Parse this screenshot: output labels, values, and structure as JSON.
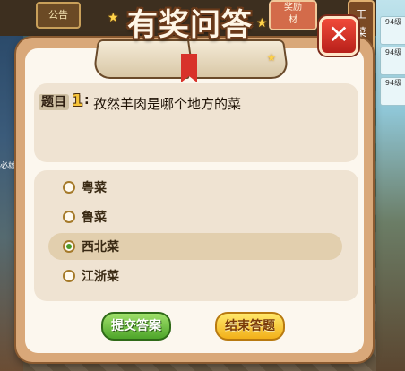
{
  "background": {
    "notice_label": "公告",
    "corner_chip": "奖励\n材",
    "sidebar_tab": "工\n菜",
    "right_cards": [
      "94级",
      "94级",
      "94级"
    ],
    "left_text": "必雄"
  },
  "dialog": {
    "title": "有奖问答",
    "close_glyph": "✕",
    "question": {
      "label": "题目",
      "number": "1",
      "colon": ":",
      "text": "孜然羊肉是哪个地方的菜"
    },
    "options": [
      {
        "label": "粤菜",
        "selected": false
      },
      {
        "label": "鲁菜",
        "selected": false
      },
      {
        "label": "西北菜",
        "selected": true
      },
      {
        "label": "江浙菜",
        "selected": false
      }
    ],
    "submit_label": "提交答案",
    "end_label": "结束答题"
  },
  "colors": {
    "accent_green": "#4ea52a",
    "accent_yellow": "#f2b01a",
    "close_red": "#d8322a"
  }
}
